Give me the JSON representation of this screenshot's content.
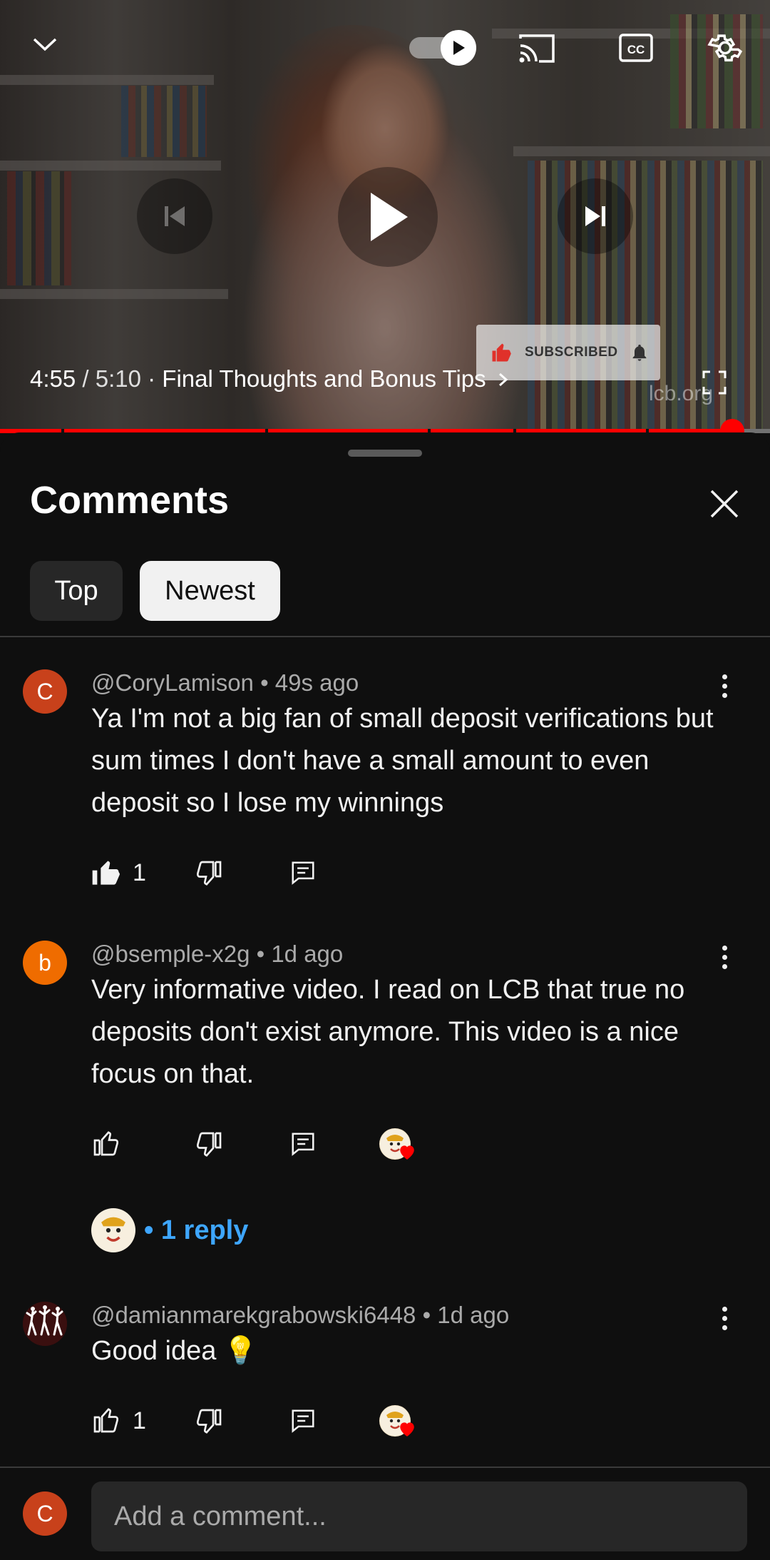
{
  "player": {
    "current_time": "4:55",
    "separator": " / ",
    "duration": "5:10",
    "chapter": " · Final Thoughts and Bonus Tips",
    "progress_fraction": 0.951,
    "subscribe_badge": "SUBSCRIBED",
    "watermark": "lcb.org",
    "icons": [
      "chevron-down-icon",
      "autoplay-toggle-icon",
      "cast-icon",
      "captions-icon",
      "settings-gear-icon",
      "previous-icon",
      "play-icon",
      "next-icon",
      "fullscreen-icon"
    ]
  },
  "comments_panel": {
    "title": "Comments",
    "filters": [
      {
        "label": "Top",
        "selected": false
      },
      {
        "label": "Newest",
        "selected": true
      }
    ],
    "comments": [
      {
        "avatar_letter": "C",
        "avatar_color": "#c8411b",
        "author": "@CoryLamison",
        "time": "49s ago",
        "text": "Ya I'm not a big fan of small deposit verifications but sum times I don't have a small amount to even deposit so I lose my winnings",
        "likes": "1",
        "liked": true
      },
      {
        "avatar_letter": "b",
        "avatar_color": "#ef6c00",
        "author": "@bsemple-x2g",
        "time": "1d ago",
        "text": "Very informative video. I read on LCB that true no deposits don't exist anymore.  This video is a nice focus on that.",
        "likes": "",
        "creator_hearted": true,
        "replies": "• 1 reply"
      },
      {
        "avatar_letter": "",
        "avatar_color": "#3a0f0f",
        "author": "@damianmarekgrabowski6448",
        "time": "1d ago",
        "text": "Good idea 💡",
        "likes": "1",
        "creator_hearted": true
      }
    ],
    "add_comment": {
      "avatar_letter": "C",
      "placeholder": "Add a comment..."
    }
  },
  "colors": {
    "accent_red": "#ff0000",
    "link_blue": "#3ea6ff",
    "background": "#0f0f0f"
  }
}
